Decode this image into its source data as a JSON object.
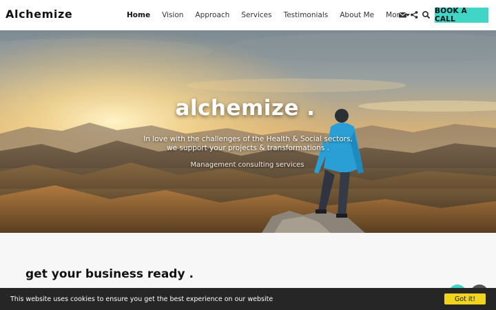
{
  "header": {
    "logo": "Alchemize",
    "nav": [
      {
        "label": "Home"
      },
      {
        "label": "Vision"
      },
      {
        "label": "Approach"
      },
      {
        "label": "Services"
      },
      {
        "label": "Testimonials"
      },
      {
        "label": "About Me"
      },
      {
        "label": "More"
      }
    ],
    "icons": [
      "envelope-icon",
      "share-icon",
      "search-icon"
    ],
    "cta_label": "BOOK A CALL"
  },
  "hero": {
    "title": "alchemize .",
    "line1": "In love with the challenges of the Health & Social sectors,",
    "line2": "we support your projects & transformations .",
    "tagline": "Management consulting services"
  },
  "section": {
    "title": "get your business ready ."
  },
  "cookie": {
    "text": "This website uses cookies to ensure you get the best experience on our website",
    "button": "Got it!"
  },
  "colors": {
    "accent": "#3fd6c8",
    "cookie_bar": "#262626",
    "cookie_button": "#f0d51c"
  }
}
